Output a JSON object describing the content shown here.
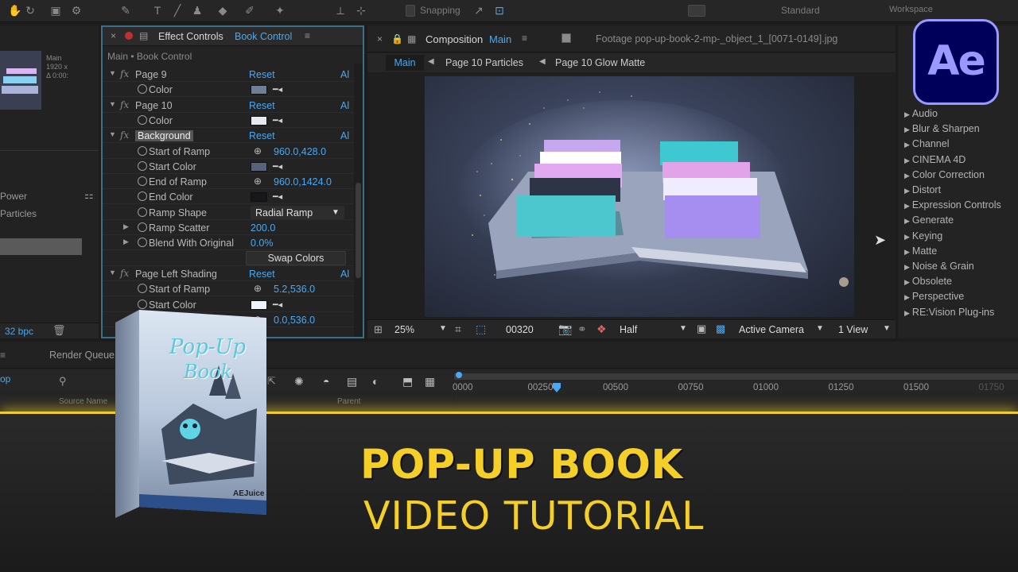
{
  "toolbar": {
    "snapping_label": "Snapping",
    "workspace_label": "Standard",
    "workspace_right": "Workspace"
  },
  "effect_controls": {
    "tab_prefix": "Effect Controls",
    "tab_layer": "Book Control",
    "breadcrumb": "Main • Book Control",
    "rows": [
      {
        "kind": "fx",
        "label": "Page 9",
        "reset": "Reset",
        "ab": "Al"
      },
      {
        "kind": "color",
        "label": "Color",
        "color": "#6f7f96"
      },
      {
        "kind": "fx",
        "label": "Page 10",
        "reset": "Reset",
        "ab": "Al"
      },
      {
        "kind": "color",
        "label": "Color",
        "color": "#e8e8f0"
      },
      {
        "kind": "fx",
        "label": "Background",
        "reset": "Reset",
        "ab": "Al"
      },
      {
        "kind": "point",
        "label": "Start of Ramp",
        "value": "960.0,428.0"
      },
      {
        "kind": "color",
        "label": "Start Color",
        "color": "#58627a"
      },
      {
        "kind": "point",
        "label": "End of Ramp",
        "value": "960.0,1424.0"
      },
      {
        "kind": "color",
        "label": "End Color",
        "color": "#16161b"
      },
      {
        "kind": "dropdown",
        "label": "Ramp Shape",
        "value": "Radial Ramp"
      },
      {
        "kind": "value",
        "label": "Ramp Scatter",
        "value": "200.0"
      },
      {
        "kind": "value",
        "label": "Blend With Original",
        "value": "0.0%"
      },
      {
        "kind": "button",
        "label": "Swap Colors"
      },
      {
        "kind": "fx",
        "label": "Page Left Shading",
        "reset": "Reset",
        "ab": "Al"
      },
      {
        "kind": "point",
        "label": "Start of Ramp",
        "value": "5.2,536.0"
      },
      {
        "kind": "color",
        "label": "Start Color",
        "color": "#f0f4fa"
      },
      {
        "kind": "point",
        "label": "End of Ramp",
        "value": "0.0,536.0"
      }
    ],
    "bpc": "32 bpc"
  },
  "left_panel": {
    "item1": "Power",
    "item2": "Particles"
  },
  "composition": {
    "tab_label": "Composition",
    "tab_name": "Main",
    "footage_tab": "Footage  pop-up-book-2-mp-_object_1_[0071-0149].jpg",
    "breadcrumbs": [
      "Main",
      "Page 10 Particles",
      "Page 10 Glow Matte"
    ],
    "zoom": "25%",
    "timecode": "00320",
    "resolution": "Half",
    "camera": "Active Camera",
    "views": "1 View"
  },
  "effects_list": [
    "Audio",
    "Blur & Sharpen",
    "Channel",
    "CINEMA 4D",
    "Color Correction",
    "Distort",
    "Expression Controls",
    "Generate",
    "Keying",
    "Matte",
    "Noise & Grain",
    "Obsolete",
    "Perspective",
    "RE:Vision Plug-ins"
  ],
  "timeline": {
    "render_queue": "Render Queue",
    "source_name": "Source Name",
    "parent": "Parent",
    "ticks": [
      "0000",
      "00250",
      "00500",
      "00750",
      "01000",
      "01250",
      "01500",
      "01750"
    ]
  },
  "app_logo": "Ae",
  "product_box": {
    "line1": "Pop-Up",
    "line2": "Book",
    "brand": "AEJuice"
  },
  "banner": {
    "title": "POP-UP BOOK",
    "subtitle": "VIDEO TUTORIAL"
  },
  "colors": {
    "accent_blue": "#4aa8f0",
    "banner_yellow": "#f4cf28",
    "ae_bg": "#00005b",
    "ae_fg": "#9999ff"
  }
}
